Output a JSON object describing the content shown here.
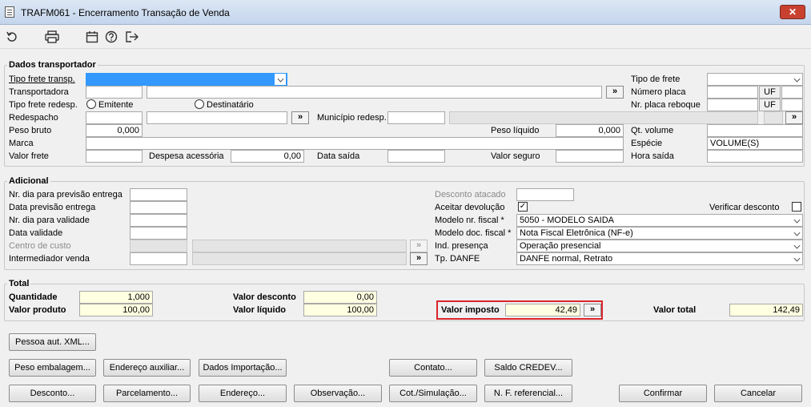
{
  "window": {
    "title": "TRAFM061 - Encerramento Transação de Venda",
    "close": "✕"
  },
  "toolbar": {
    "icons": [
      "refresh-icon",
      "print-icon",
      "calendar-icon",
      "help-icon",
      "exit-icon"
    ]
  },
  "transportador": {
    "title": "Dados transportador",
    "tipo_frete_transp": "Tipo frete transp.",
    "transportadora": "Transportadora",
    "tipo_frete_redesp": "Tipo frete redesp.",
    "emitente": "Emitente",
    "destinatario": "Destinatário",
    "redespacho": "Redespacho",
    "municipio_redesp": "Município redesp.",
    "peso_bruto": "Peso bruto",
    "peso_bruto_val": "0,000",
    "peso_liquido": "Peso líquido",
    "peso_liquido_val": "0,000",
    "marca": "Marca",
    "valor_frete": "Valor frete",
    "despesa_acessoria": "Despesa acessória",
    "despesa_acessoria_val": "0,00",
    "data_saida": "Data saída",
    "valor_seguro": "Valor seguro",
    "tipo_de_frete": "Tipo de frete",
    "numero_placa": "Número placa",
    "nr_placa_reboque": "Nr. placa reboque",
    "uf": "UF",
    "qt_volume": "Qt. volume",
    "especie": "Espécie",
    "especie_val": "VOLUME(S)",
    "hora_saida": "Hora saída",
    "lookup": "»"
  },
  "adicional": {
    "title": "Adicional",
    "nr_dia_previsao": "Nr. dia para previsão entrega",
    "data_previsao": "Data previsão entrega",
    "nr_dia_validade": "Nr. dia para validade",
    "data_validade": "Data validade",
    "centro_custo": "Centro de custo",
    "intermediador": "Intermediador venda",
    "desconto_atacado": "Desconto atacado",
    "aceitar_devolucao": "Aceitar devolução",
    "aceitar_check": "✓",
    "verificar_desconto": "Verificar desconto",
    "modelo_nr_fiscal": "Modelo nr. fiscal *",
    "modelo_nr_fiscal_val": "5050 - MODELO SAIDA",
    "modelo_doc_fiscal": "Modelo doc. fiscal *",
    "modelo_doc_fiscal_val": "Nota Fiscal Eletrônica (NF-e)",
    "ind_presenca": "Ind. presença",
    "ind_presenca_val": "Operação presencial",
    "tp_danfe": "Tp. DANFE",
    "tp_danfe_val": "DANFE normal, Retrato"
  },
  "total": {
    "title": "Total",
    "quantidade": "Quantidade",
    "quantidade_val": "1,000",
    "valor_produto": "Valor produto",
    "valor_produto_val": "100,00",
    "valor_desconto": "Valor desconto",
    "valor_desconto_val": "0,00",
    "valor_liquido": "Valor líquido",
    "valor_liquido_val": "100,00",
    "valor_imposto": "Valor imposto",
    "valor_imposto_val": "42,49",
    "valor_total": "Valor total",
    "valor_total_val": "142,49"
  },
  "buttons": {
    "pessoa_xml": "Pessoa aut. XML...",
    "peso_embalagem": "Peso embalagem...",
    "endereco_auxiliar": "Endereço auxiliar...",
    "dados_importacao": "Dados Importação...",
    "contato": "Contato...",
    "saldo_credev": "Saldo CREDEV...",
    "desconto": "Desconto...",
    "parcelamento": "Parcelamento...",
    "endereco": "Endereço...",
    "observacao": "Observação...",
    "cot_simulacao": "Cot./Simulação...",
    "nf_referencial": "N. F. referencial...",
    "confirmar": "Confirmar",
    "cancelar": "Cancelar"
  },
  "colors": {
    "highlight": "#d9262c",
    "selection": "#3399ff",
    "yellow_field": "#ffffe1"
  }
}
